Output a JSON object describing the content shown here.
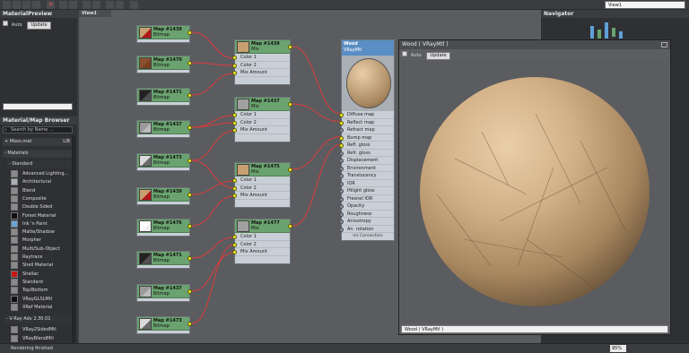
{
  "view_selector": "View1",
  "material_preview": {
    "title": "MaterialPreview",
    "auto_label": "Auto",
    "update_label": "Update"
  },
  "browser": {
    "title": "Material/Map Browser",
    "search_placeholder": "Search by Name ...",
    "moos_label": "+ Moos.mat",
    "lib_label": "LIB",
    "materials_label": "- Materials",
    "standard_label": "- Standard",
    "items": [
      {
        "label": "Advanced Lighting...",
        "swatch": "#8a8a8a"
      },
      {
        "label": "Architectural",
        "swatch": "#aab0b8"
      },
      {
        "label": "Blend",
        "swatch": "#8a8a8a"
      },
      {
        "label": "Composite",
        "swatch": "#8a8a8a"
      },
      {
        "label": "Double Sided",
        "swatch": "#8a8a8a"
      },
      {
        "label": "Forest Material",
        "swatch": "#111111"
      },
      {
        "label": "Ink 'n Paint",
        "swatch": "#6aa3d8"
      },
      {
        "label": "Matte/Shadow",
        "swatch": "#8a8a8a"
      },
      {
        "label": "Morpher",
        "swatch": "#8a8a8a"
      },
      {
        "label": "Multi/Sub-Object",
        "swatch": "#8a8a8a"
      },
      {
        "label": "Raytrace",
        "swatch": "#8a8a8a"
      },
      {
        "label": "Shell Material",
        "swatch": "#8a8a8a"
      },
      {
        "label": "Shellac",
        "swatch": "#c41818"
      },
      {
        "label": "Standard",
        "swatch": "#8a8a8a"
      },
      {
        "label": "Top/Bottom",
        "swatch": "#8a8a8a"
      },
      {
        "label": "VRayGLSLMtl",
        "swatch": "#111111"
      },
      {
        "label": "XRef Material",
        "swatch": "#8a8a8a"
      }
    ],
    "vray_label": "- V-Ray Adv 2.30.01",
    "vray_items": [
      {
        "label": "VRay2SidedMtl",
        "swatch": "#8a8a8a"
      },
      {
        "label": "VRayBlendMtl",
        "swatch": "#8a8a8a"
      }
    ]
  },
  "viewport": {
    "tab": "View1"
  },
  "map_nodes": [
    {
      "title": "Map #1439",
      "sub": "Bitmap",
      "thumb": "#c8a070",
      "thumb2": "#b01818"
    },
    {
      "title": "Map #1470",
      "sub": "Bitmap",
      "thumb": "#8a5030",
      "thumb2": "#7a4020"
    },
    {
      "title": "Map #1471",
      "sub": "Bitmap",
      "thumb": "#222222",
      "thumb2": "#505050"
    },
    {
      "title": "Map #1437",
      "sub": "Bitmap",
      "thumb": "#9a9a9a",
      "thumb2": "#bcbcbc"
    },
    {
      "title": "Map #1473",
      "sub": "Bitmap",
      "thumb": "#dadada",
      "thumb2": "#6a6a6a"
    },
    {
      "title": "Map #1439",
      "sub": "Bitmap",
      "thumb": "#c8a070",
      "thumb2": "#b01818"
    },
    {
      "title": "Map #1476",
      "sub": "Bitmap",
      "thumb": "#ffffff",
      "thumb2": "#f0f0f0"
    },
    {
      "title": "Map #1471",
      "sub": "Bitmap",
      "thumb": "#222222",
      "thumb2": "#505050"
    },
    {
      "title": "Map #1437",
      "sub": "Bitmap",
      "thumb": "#9a9a9a",
      "thumb2": "#bcbcbc"
    },
    {
      "title": "Map #1473",
      "sub": "Bitmap",
      "thumb": "#dadada",
      "thumb2": "#6a6a6a"
    }
  ],
  "mix_nodes": [
    {
      "title": "Map #1439",
      "sub": "Mix",
      "thumb": "#c8a070",
      "slots": [
        "Color 1",
        "Color 2",
        "Mix Amount"
      ]
    },
    {
      "title": "Map #1437",
      "sub": "Mix",
      "thumb": "#a0a0a0",
      "slots": [
        "Color 1",
        "Color 2",
        "Mix Amount"
      ]
    },
    {
      "title": "Map #1475",
      "sub": "Mix",
      "thumb": "#c8a070",
      "slots": [
        "Color 1",
        "Color 2",
        "Mix Amount"
      ]
    },
    {
      "title": "Map #1477",
      "sub": "Mix",
      "thumb": "#a0a0a0",
      "slots": [
        "Color 1",
        "Color 2",
        "Mix Amount"
      ]
    }
  ],
  "material_node": {
    "title": "Wood",
    "sub": "VRayMtl",
    "slots": [
      "Diffuse map",
      "Reflect map",
      "Refract map",
      "Bump map",
      "Refl. gloss",
      "Refr. gloss",
      "Displacement",
      "Environment",
      "Translucency",
      "IOR",
      "Hilight gloss",
      "Fresnel IOR",
      "Opacity",
      "Roughness",
      "Anisotropy",
      "An. rotation"
    ],
    "connected": [
      true,
      true,
      false,
      true,
      true,
      false,
      false,
      false,
      false,
      false,
      false,
      false,
      false,
      false,
      false,
      false
    ],
    "footer": "mr Connection"
  },
  "preview_window": {
    "title": "Wood  ( VRayMtl )",
    "auto_label": "Auto",
    "update_label": "Update",
    "dropdown": "Wood  ( VRayMtl )"
  },
  "navigator": {
    "title": "Navigator"
  },
  "status": {
    "text": "Rendering finished",
    "zoom": "95%"
  },
  "colors": {
    "node_header": "#6aa36f",
    "material_header": "#5a8ec4",
    "wire": "#e03a3a",
    "socket": "#f0ea20"
  }
}
